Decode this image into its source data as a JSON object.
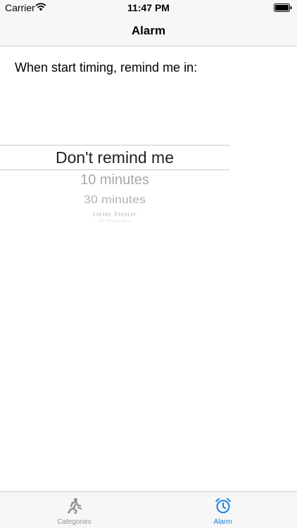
{
  "status_bar": {
    "carrier": "Carrier",
    "time": "11:47 PM",
    "wifi_icon": "wifi-icon",
    "battery_icon": "battery-icon"
  },
  "nav": {
    "title": "Alarm"
  },
  "prompt": "When start timing, remind me in:",
  "picker": {
    "selected": "Don't remind me",
    "options": [
      "10 minutes",
      "30 minutes",
      "one hour",
      "2 hours"
    ]
  },
  "tab_bar": {
    "tabs": [
      {
        "label": "Categories",
        "icon": "running-person-icon",
        "active": false
      },
      {
        "label": "Alarm",
        "icon": "alarm-clock-icon",
        "active": true
      }
    ]
  },
  "colors": {
    "accent": "#1a82e6",
    "inactive": "#929292",
    "bar_background": "#f7f7f7"
  }
}
